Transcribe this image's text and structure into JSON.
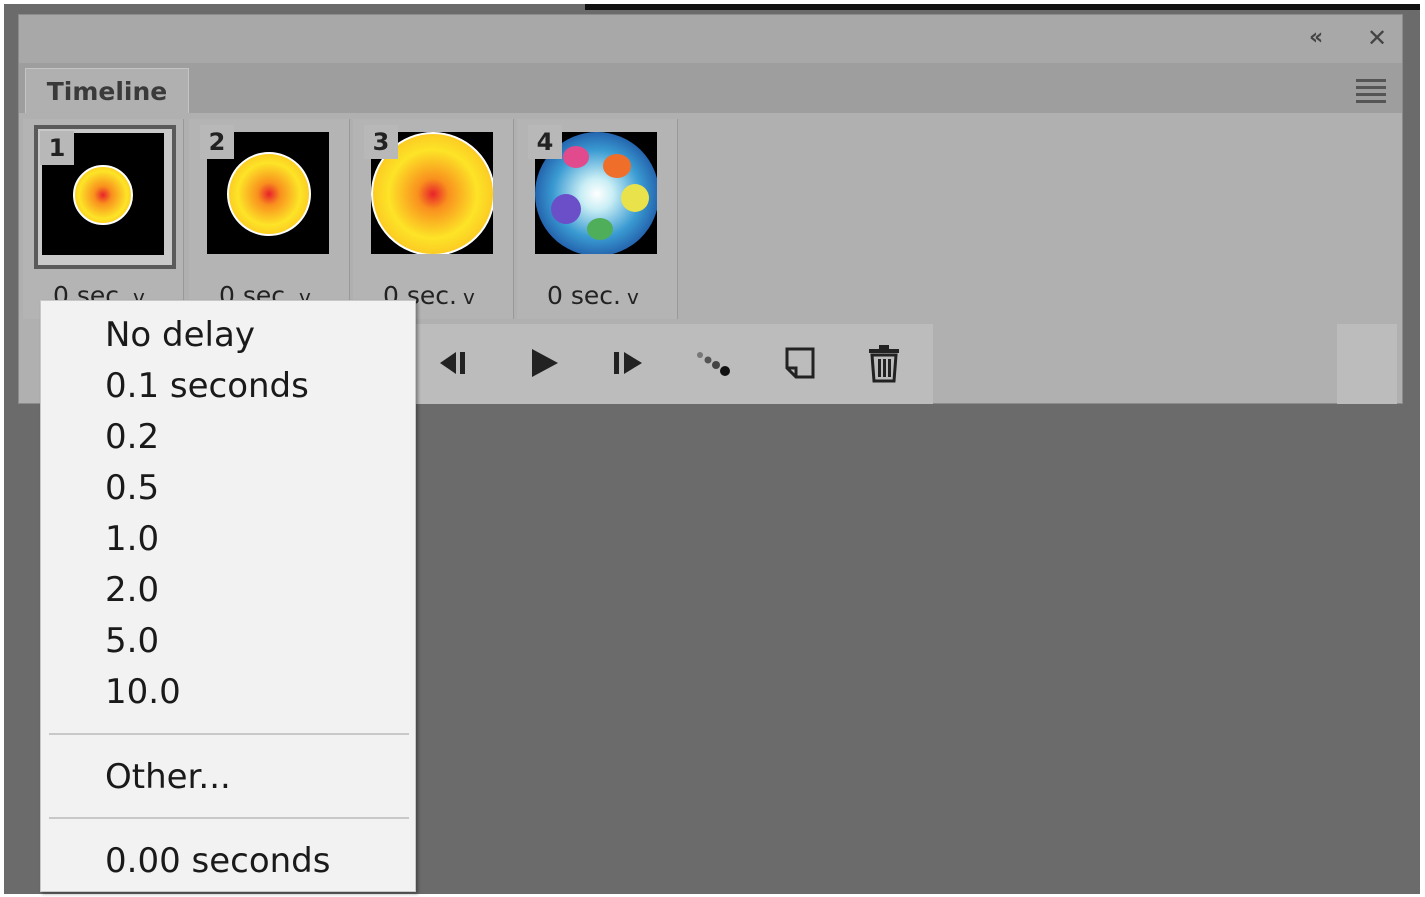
{
  "panel": {
    "title": "Timeline",
    "collapse_icon": "double-chevron-left-icon",
    "close_icon": "close-icon",
    "menu_icon": "panel-menu-icon"
  },
  "frames": [
    {
      "number": "1",
      "delay": "0 sec.",
      "selected": true
    },
    {
      "number": "2",
      "delay": "0 sec.",
      "selected": false
    },
    {
      "number": "3",
      "delay": "0 sec.",
      "selected": false
    },
    {
      "number": "4",
      "delay": "0 sec.",
      "selected": false
    }
  ],
  "controls": [
    "select-previous-frame-icon",
    "play-icon",
    "select-next-frame-icon",
    "tween-icon",
    "duplicate-frame-icon",
    "delete-frame-icon"
  ],
  "delay_menu": {
    "items": [
      "No delay",
      "0.1 seconds",
      "0.2",
      "0.5",
      "1.0",
      "2.0",
      "5.0",
      "10.0"
    ],
    "other": "Other...",
    "current": "0.00 seconds"
  },
  "colors": {
    "panel_bg": "#b0b0b0",
    "workspace_bg": "#6b6b6b",
    "menu_bg": "#f2f2f2"
  }
}
